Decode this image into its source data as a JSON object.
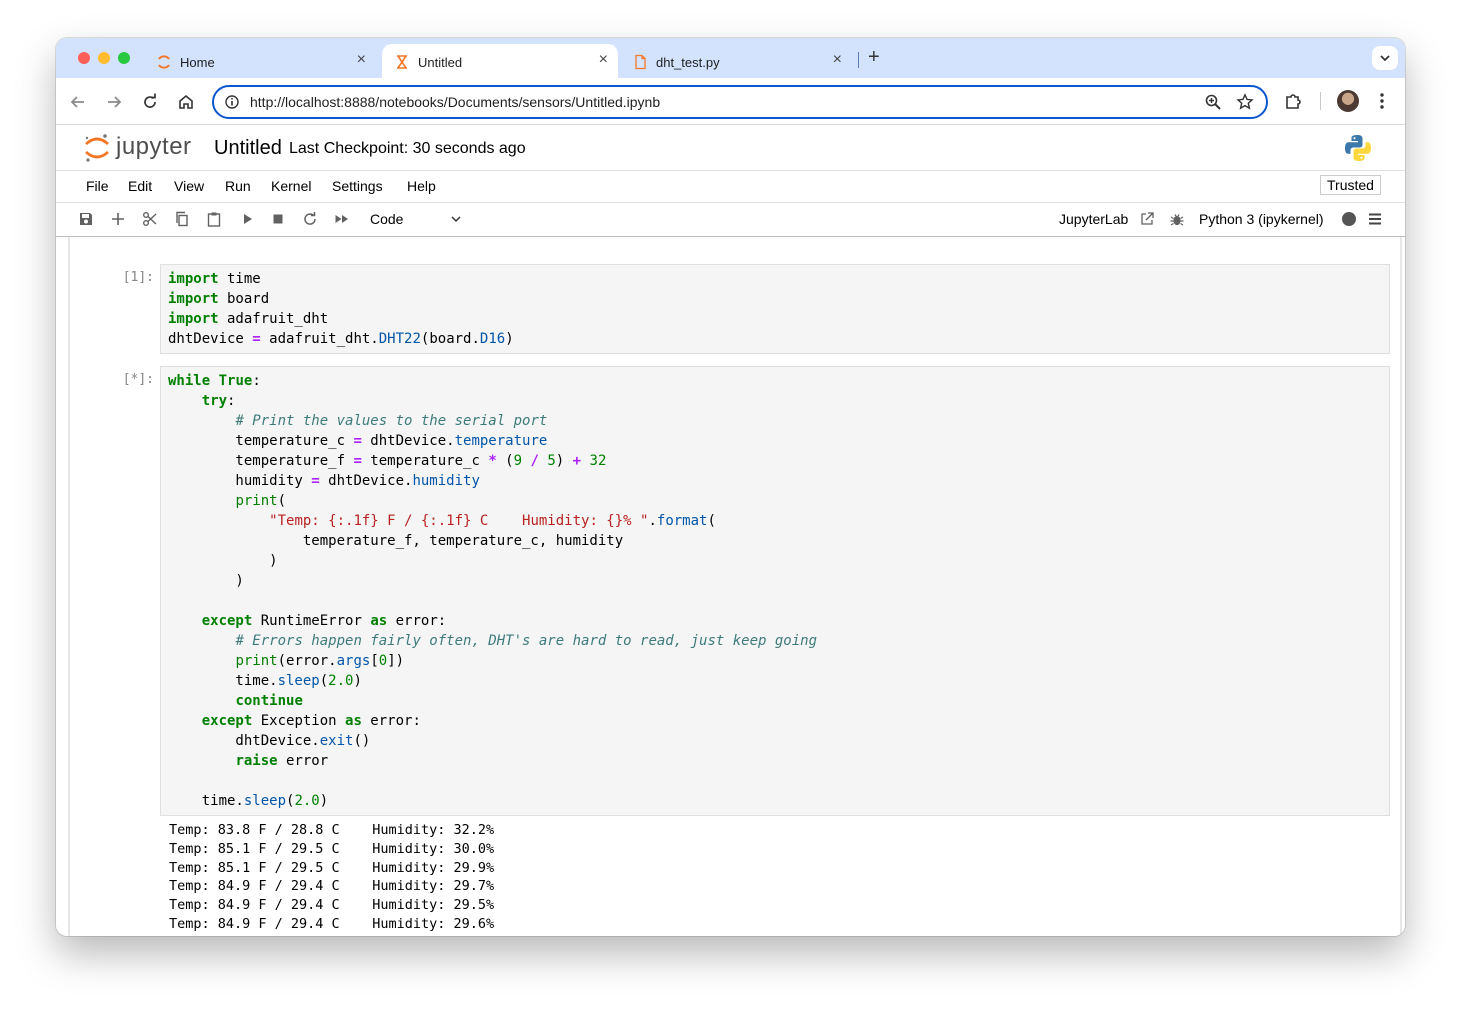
{
  "browser": {
    "tabs": [
      {
        "label": "Home",
        "active": false
      },
      {
        "label": "Untitled",
        "active": true
      },
      {
        "label": "dht_test.py",
        "active": false
      }
    ],
    "url": "http://localhost:8888/notebooks/Documents/sensors/Untitled.ipynb"
  },
  "jupyter": {
    "wordmark": "jupyter",
    "notebook_title": "Untitled",
    "checkpoint": "Last Checkpoint: 30 seconds ago",
    "menu": [
      "File",
      "Edit",
      "View",
      "Run",
      "Kernel",
      "Settings",
      "Help"
    ],
    "trusted": "Trusted",
    "toolbar": {
      "cell_type": "Code",
      "jupyterlab_link": "JupyterLab",
      "kernel_name": "Python 3 (ipykernel)"
    }
  },
  "cells": [
    {
      "prompt": "[1]:",
      "lines": [
        [
          [
            "kw",
            "import"
          ],
          [
            "",
            " time"
          ]
        ],
        [
          [
            "kw",
            "import"
          ],
          [
            "",
            " board"
          ]
        ],
        [
          [
            "kw",
            "import"
          ],
          [
            "",
            " adafruit_dht"
          ]
        ],
        [
          [
            "",
            "dhtDevice "
          ],
          [
            "op",
            "="
          ],
          [
            "",
            " adafruit_dht."
          ],
          [
            "att",
            "DHT22"
          ],
          [
            "",
            "(board."
          ],
          [
            "att",
            "D16"
          ],
          [
            "",
            ")"
          ]
        ]
      ]
    },
    {
      "prompt": "[*]:",
      "lines": [
        [
          [
            "kw",
            "while"
          ],
          [
            "",
            " "
          ],
          [
            "kw",
            "True"
          ],
          [
            "",
            ":"
          ]
        ],
        [
          [
            "",
            "    "
          ],
          [
            "kw",
            "try"
          ],
          [
            "",
            ":"
          ]
        ],
        [
          [
            "",
            "        "
          ],
          [
            "cm",
            "# Print the values to the serial port"
          ]
        ],
        [
          [
            "",
            "        temperature_c "
          ],
          [
            "op",
            "="
          ],
          [
            "",
            " dhtDevice."
          ],
          [
            "att",
            "temperature"
          ]
        ],
        [
          [
            "",
            "        temperature_f "
          ],
          [
            "op",
            "="
          ],
          [
            "",
            " temperature_c "
          ],
          [
            "op",
            "*"
          ],
          [
            "",
            " ("
          ],
          [
            "num",
            "9"
          ],
          [
            "",
            " "
          ],
          [
            "op",
            "/"
          ],
          [
            "",
            " "
          ],
          [
            "num",
            "5"
          ],
          [
            "",
            ") "
          ],
          [
            "op",
            "+"
          ],
          [
            "",
            " "
          ],
          [
            "num",
            "32"
          ]
        ],
        [
          [
            "",
            "        humidity "
          ],
          [
            "op",
            "="
          ],
          [
            "",
            " dhtDevice."
          ],
          [
            "att",
            "humidity"
          ]
        ],
        [
          [
            "",
            "        "
          ],
          [
            "bp",
            "print"
          ],
          [
            "",
            "("
          ]
        ],
        [
          [
            "",
            "            "
          ],
          [
            "str",
            "\"Temp: {:.1f} F / {:.1f} C    Humidity: {}% \""
          ],
          [
            "",
            "."
          ],
          [
            "att",
            "format"
          ],
          [
            "",
            "("
          ]
        ],
        [
          [
            "",
            "                temperature_f, temperature_c, humidity"
          ]
        ],
        [
          [
            "",
            "            )"
          ]
        ],
        [
          [
            "",
            "        )"
          ]
        ],
        [
          [
            "",
            ""
          ]
        ],
        [
          [
            "",
            "    "
          ],
          [
            "kw",
            "except"
          ],
          [
            "",
            " RuntimeError "
          ],
          [
            "kw",
            "as"
          ],
          [
            "",
            " error:"
          ]
        ],
        [
          [
            "",
            "        "
          ],
          [
            "cm",
            "# Errors happen fairly often, DHT's are hard to read, just keep going"
          ]
        ],
        [
          [
            "",
            "        "
          ],
          [
            "bp",
            "print"
          ],
          [
            "",
            "(error."
          ],
          [
            "att",
            "args"
          ],
          [
            "",
            "["
          ],
          [
            "num",
            "0"
          ],
          [
            "",
            "])"
          ]
        ],
        [
          [
            "",
            "        time."
          ],
          [
            "att",
            "sleep"
          ],
          [
            "",
            "("
          ],
          [
            "num",
            "2.0"
          ],
          [
            "",
            ")"
          ]
        ],
        [
          [
            "",
            "        "
          ],
          [
            "kw",
            "continue"
          ]
        ],
        [
          [
            "",
            "    "
          ],
          [
            "kw",
            "except"
          ],
          [
            "",
            " Exception "
          ],
          [
            "kw",
            "as"
          ],
          [
            "",
            " error:"
          ]
        ],
        [
          [
            "",
            "        dhtDevice."
          ],
          [
            "att",
            "exit"
          ],
          [
            "",
            "()"
          ]
        ],
        [
          [
            "",
            "        "
          ],
          [
            "kw",
            "raise"
          ],
          [
            "",
            " error"
          ]
        ],
        [
          [
            "",
            ""
          ]
        ],
        [
          [
            "",
            "    time."
          ],
          [
            "att",
            "sleep"
          ],
          [
            "",
            "("
          ],
          [
            "num",
            "2.0"
          ],
          [
            "",
            ")"
          ]
        ]
      ],
      "output": [
        "Temp: 83.8 F / 28.8 C    Humidity: 32.2%",
        "Temp: 85.1 F / 29.5 C    Humidity: 30.0%",
        "Temp: 85.1 F / 29.5 C    Humidity: 29.9%",
        "Temp: 84.9 F / 29.4 C    Humidity: 29.7%",
        "Temp: 84.9 F / 29.4 C    Humidity: 29.5%",
        "Temp: 84.9 F / 29.4 C    Humidity: 29.6%"
      ]
    }
  ],
  "icons": {
    "tabstrip": [
      "home-tab-icon",
      "jupyter-tab-icon",
      "file-tab-icon",
      "close-icon",
      "plus-icon",
      "chevron-down-icon"
    ],
    "addressbar": [
      "back-arrow-icon",
      "forward-arrow-icon",
      "reload-icon",
      "home-icon",
      "site-info-icon",
      "zoom-icon",
      "star-icon",
      "extensions-icon",
      "profile-avatar",
      "more-vert-icon"
    ],
    "toolbar": [
      "save-icon",
      "insert-cell-icon",
      "cut-icon",
      "copy-icon",
      "paste-icon",
      "run-icon",
      "stop-icon",
      "restart-icon",
      "fast-forward-icon",
      "external-link-icon",
      "debugger-icon",
      "kernel-busy-indicator",
      "menu-icon"
    ]
  },
  "colors": {
    "tabstrip_bg": "#d3e3fd",
    "omnibox_border": "#0b57d0",
    "jupyter_orange": "#f37726",
    "code_keyword": "#008000",
    "code_string": "#ba2121",
    "code_comment": "#3d7b7b",
    "code_operator": "#aa22ff",
    "code_attribute": "#0055aa"
  }
}
